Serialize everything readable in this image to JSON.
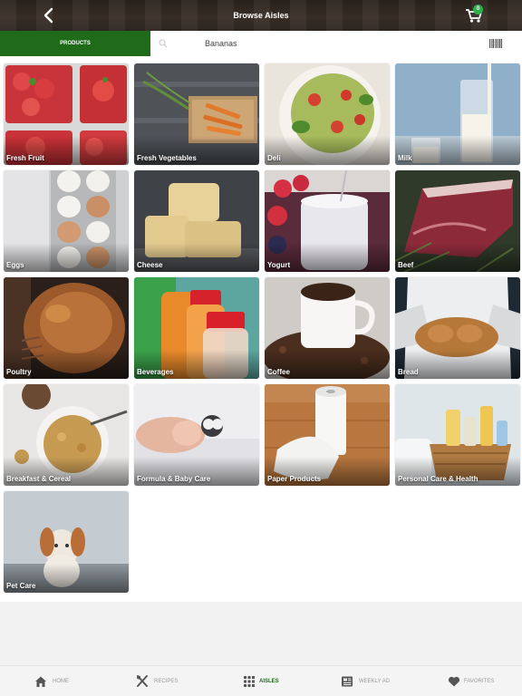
{
  "header": {
    "title": "Browse Aisles",
    "cart_count": "0"
  },
  "search": {
    "tab_label": "PRODUCTS",
    "value": "Bananas"
  },
  "aisles": [
    {
      "label": "Fresh Fruit"
    },
    {
      "label": "Fresh Vegetables"
    },
    {
      "label": "Deli"
    },
    {
      "label": "Milk"
    },
    {
      "label": "Eggs"
    },
    {
      "label": "Cheese"
    },
    {
      "label": "Yogurt"
    },
    {
      "label": "Beef"
    },
    {
      "label": "Poultry"
    },
    {
      "label": "Beverages"
    },
    {
      "label": "Coffee"
    },
    {
      "label": "Bread"
    },
    {
      "label": "Breakfast & Cereal"
    },
    {
      "label": "Formula & Baby Care"
    },
    {
      "label": "Paper Products"
    },
    {
      "label": "Personal Care & Health"
    },
    {
      "label": "Pet Care"
    }
  ],
  "tabbar": {
    "items": [
      {
        "label": "HOME",
        "icon": "home-icon"
      },
      {
        "label": "RECIPES",
        "icon": "utensils-icon"
      },
      {
        "label": "AISLES",
        "icon": "grid-icon"
      },
      {
        "label": "WEEKLY AD",
        "icon": "newspaper-icon"
      },
      {
        "label": "FAVORITES",
        "icon": "heart-icon"
      }
    ],
    "active": "AISLES"
  },
  "colors": {
    "brand_green": "#1f6b1a",
    "badge_green": "#2bb34a"
  }
}
